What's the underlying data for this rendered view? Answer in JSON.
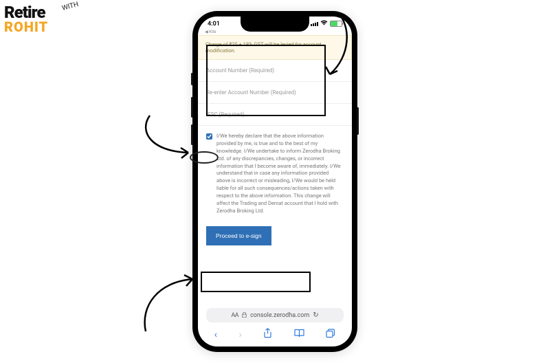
{
  "logo": {
    "top": "Retire",
    "bottom": "ROHIT",
    "extra": "WITH"
  },
  "status": {
    "time": "4:01"
  },
  "tab": "Kite",
  "banner": "Charge of ₹25 + 18% GST will be levied for account modification.",
  "fields": {
    "account_number": {
      "label": "Account Number (Required)"
    },
    "reenter_account_number": {
      "label": "Re-enter Account Number (Required)"
    },
    "ifsc": {
      "label": "IFSC (Required)"
    }
  },
  "declaration": {
    "checked": true,
    "text": "I/We hereby declare that the above information provided by me, is true and to the best of my knowledge. I/We undertake to inform Zerodha Broking Ltd. of any discrepancies, changes, or incorrect information that I become aware of, immediately. I/We understand that in case any information provided above is incorrect or misleading, I/We would be held liable for all such consequences/actions taken with respect to the above information. This change will affect the Trading and Demat account that I hold with Zerodha Broking Ltd."
  },
  "button": {
    "proceed": "Proceed to e-sign"
  },
  "browser": {
    "aa": "AA",
    "url": "console.zerodha.com"
  }
}
